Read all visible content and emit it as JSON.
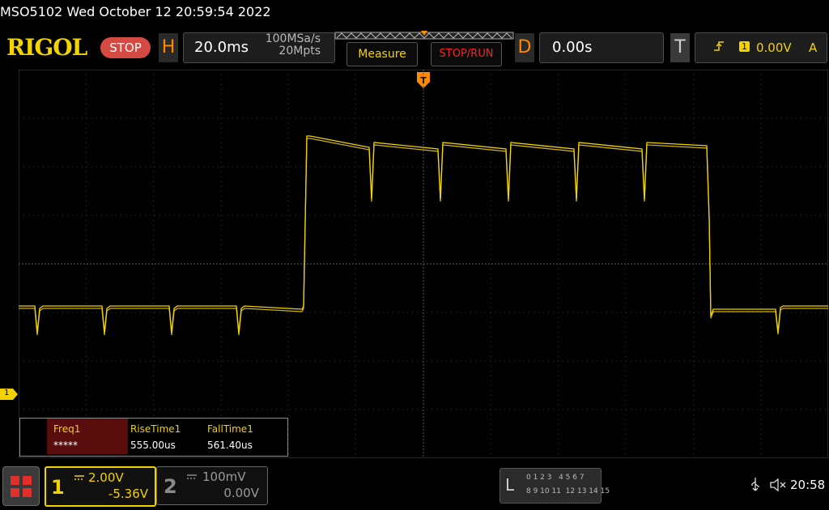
{
  "header": {
    "model_datetime": "MSO5102  Wed October 12 20:59:54 2022",
    "brand": "RIGOL",
    "status_button": "STOP",
    "horizontal": {
      "letter": "H",
      "timebase": "20.0ms",
      "sample_rate": "100MSa/s",
      "memory_depth": "20Mpts"
    },
    "measure_button": "Measure",
    "stoprun_button": "STOP/RUN",
    "delay": {
      "letter": "D",
      "value": "0.00s"
    },
    "trigger": {
      "letter": "T",
      "channel": "1",
      "level": "0.00V",
      "mode": "A"
    }
  },
  "trigger_marker": "T",
  "channel_marker": "1",
  "measurements": [
    {
      "name": "Freq1",
      "value": "*****"
    },
    {
      "name": "RiseTime1",
      "value": "555.00us"
    },
    {
      "name": "FallTime1",
      "value": "561.40us"
    }
  ],
  "channels": [
    {
      "number": "1",
      "scale": "2.00V",
      "offset": "-5.36V"
    },
    {
      "number": "2",
      "scale": "100mV",
      "offset": "0.00V"
    }
  ],
  "logic": {
    "letter": "L",
    "row1": "0 1 2 3   4 5 6 7",
    "row2": "8 9 10 11  12 13 14 15"
  },
  "clock": "20:58",
  "colors": {
    "ch1": "#f2d200",
    "accent": "#ff8a00",
    "stop": "#d44a42",
    "grid": "#3a3a3a"
  }
}
